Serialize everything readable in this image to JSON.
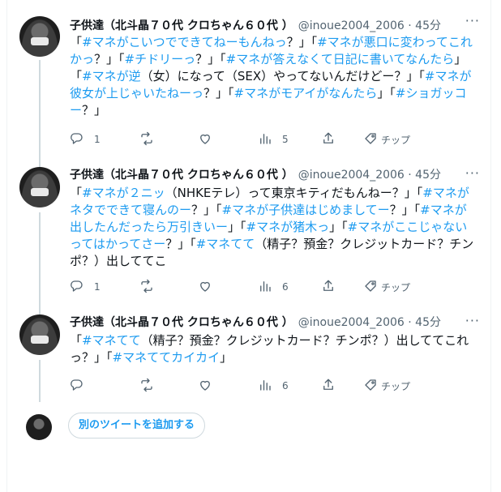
{
  "tweets": [
    {
      "name": "子供達（北斗晶７０代 クロちゃん６０代 ）",
      "handle": "@inoue2004_2006 · 45分",
      "segments": [
        {
          "t": "「",
          "tag": false
        },
        {
          "t": "#マネがこいつでできてねーもんねっ",
          "tag": true
        },
        {
          "t": "？」「",
          "tag": false
        },
        {
          "t": "#マネが悪口に変わってこれかっ",
          "tag": true
        },
        {
          "t": "？」「",
          "tag": false
        },
        {
          "t": "#チドリーっ",
          "tag": true
        },
        {
          "t": "？」「",
          "tag": false
        },
        {
          "t": "#マネが答えなくて日記に書いてなんたら",
          "tag": true
        },
        {
          "t": "」「",
          "tag": false
        },
        {
          "t": "#マネが逆",
          "tag": true
        },
        {
          "t": "（女）になって（SEX）やってないんだけどー？」「",
          "tag": false
        },
        {
          "t": "#マネが彼女が上じゃいたねーっ",
          "tag": true
        },
        {
          "t": "？」「",
          "tag": false
        },
        {
          "t": "#マネがモアイがなんたら",
          "tag": true
        },
        {
          "t": "」「",
          "tag": false
        },
        {
          "t": "#ショガッコー",
          "tag": true
        },
        {
          "t": "？」",
          "tag": false
        }
      ],
      "reply_count": "1",
      "retweet_count": "",
      "like_count": "",
      "view_count": "5",
      "tip_label": "チップ"
    },
    {
      "name": "子供達（北斗晶７０代 クロちゃん６０代 ）",
      "handle": "@inoue2004_2006 · 45分",
      "segments": [
        {
          "t": "「",
          "tag": false
        },
        {
          "t": "#マネが２ニッ",
          "tag": true
        },
        {
          "t": "（NHKEテレ）って東京キティだもんねー？」「",
          "tag": false
        },
        {
          "t": "#マネがネタでできて寝んのー",
          "tag": true
        },
        {
          "t": "？」「",
          "tag": false
        },
        {
          "t": "#マネが子供達はじめましてー",
          "tag": true
        },
        {
          "t": "？」「",
          "tag": false
        },
        {
          "t": "#マネが出したんだったら万引きいー",
          "tag": true
        },
        {
          "t": "」「",
          "tag": false
        },
        {
          "t": "#マネが猪木っ",
          "tag": true
        },
        {
          "t": "」「",
          "tag": false
        },
        {
          "t": "#マネがここじゃないってはかってさー",
          "tag": true
        },
        {
          "t": "？」「",
          "tag": false
        },
        {
          "t": "#マネてて",
          "tag": true
        },
        {
          "t": "（精子？預金？クレジットカード？チンポ？）出しててこ",
          "tag": false
        }
      ],
      "reply_count": "1",
      "retweet_count": "",
      "like_count": "",
      "view_count": "6",
      "tip_label": "チップ"
    },
    {
      "name": "子供達（北斗晶７０代 クロちゃん６０代 ）",
      "handle": "@inoue2004_2006 · 45分",
      "segments": [
        {
          "t": "「",
          "tag": false
        },
        {
          "t": "#マネてて",
          "tag": true
        },
        {
          "t": "（精子？預金？クレジットカード？チンポ？）出しててこれっ？」「",
          "tag": false
        },
        {
          "t": "#マネててカイカイ",
          "tag": true
        },
        {
          "t": "」",
          "tag": false
        }
      ],
      "reply_count": "",
      "retweet_count": "",
      "like_count": "",
      "view_count": "6",
      "tip_label": "チップ"
    }
  ],
  "add_tweet_label": "別のツイートを追加する",
  "more_label": "···",
  "colors": {
    "link": "#1d9bf0",
    "text": "#0f1419",
    "muted": "#536471"
  },
  "icons": [
    "reply-icon",
    "retweet-icon",
    "like-icon",
    "views-icon",
    "share-icon",
    "tip-icon",
    "more-icon"
  ]
}
